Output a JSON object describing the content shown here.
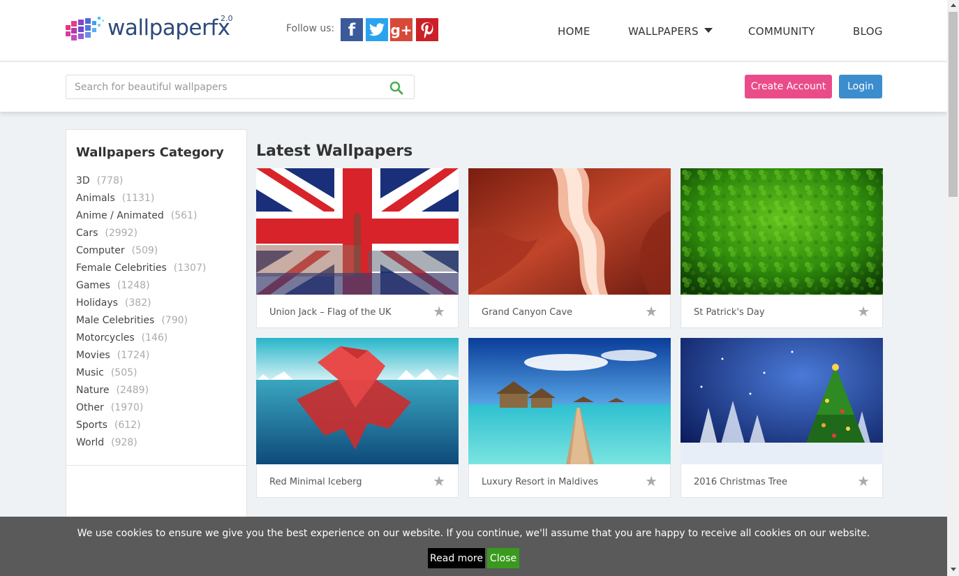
{
  "header": {
    "logo_text": "wallpaperfx",
    "logo_sup": "2.0",
    "follow_label": "Follow us:",
    "social": [
      "facebook-icon",
      "twitter-icon",
      "google-plus-icon",
      "pinterest-icon"
    ],
    "nav": {
      "home": "HOME",
      "wallpapers": "WALLPAPERS",
      "community": "COMMUNITY",
      "blog": "BLOG"
    }
  },
  "search": {
    "placeholder": "Search for beautiful wallpapers",
    "value": ""
  },
  "auth": {
    "create_account": "Create Account",
    "login": "Login"
  },
  "sidebar": {
    "title": "Wallpapers Category",
    "categories": [
      {
        "name": "3D",
        "count": "(778)"
      },
      {
        "name": "Animals",
        "count": "(1131)"
      },
      {
        "name": "Anime / Animated",
        "count": "(561)"
      },
      {
        "name": "Cars",
        "count": "(2992)"
      },
      {
        "name": "Computer",
        "count": "(509)"
      },
      {
        "name": "Female Celebrities",
        "count": "(1307)"
      },
      {
        "name": "Games",
        "count": "(1248)"
      },
      {
        "name": "Holidays",
        "count": "(382)"
      },
      {
        "name": "Male Celebrities",
        "count": "(790)"
      },
      {
        "name": "Motorcycles",
        "count": "(146)"
      },
      {
        "name": "Movies",
        "count": "(1724)"
      },
      {
        "name": "Music",
        "count": "(505)"
      },
      {
        "name": "Nature",
        "count": "(2489)"
      },
      {
        "name": "Other",
        "count": "(1970)"
      },
      {
        "name": "Sports",
        "count": "(612)"
      },
      {
        "name": "World",
        "count": "(928)"
      }
    ]
  },
  "main": {
    "title": "Latest Wallpapers",
    "wallpapers": [
      {
        "title": "Union Jack – Flag of the UK"
      },
      {
        "title": "Grand Canyon Cave"
      },
      {
        "title": "St Patrick's Day"
      },
      {
        "title": "Red Minimal Iceberg"
      },
      {
        "title": "Luxury Resort in Maldives"
      },
      {
        "title": "2016 Christmas Tree"
      }
    ]
  },
  "cookie": {
    "text": "We use cookies to ensure we give you the best experience on our website. If you continue, we'll assume that you are happy to receive all cookies on our website.",
    "read_more": "Read more",
    "close": "Close"
  },
  "colors": {
    "brand": "#2d4a7a",
    "create_account": "#ea4c89",
    "login": "#3c8dce",
    "search_icon": "#4caf50",
    "close": "#3a9a1e"
  }
}
